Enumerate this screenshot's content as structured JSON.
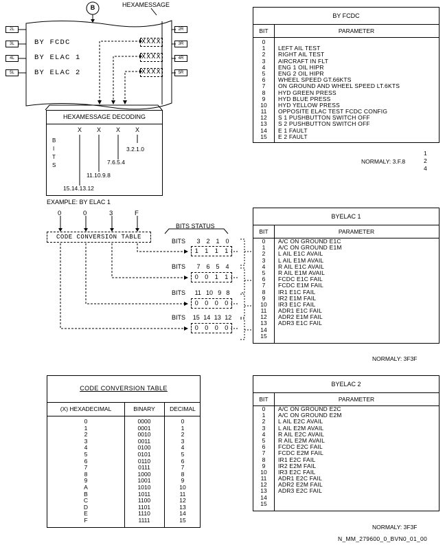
{
  "top_left": {
    "circle_label": "B",
    "hexamessage_label": "HEXAMESSAGE",
    "left_buttons": [
      "2L",
      "3L",
      "4L",
      "5L"
    ],
    "right_buttons": [
      "2R",
      "3R",
      "4R",
      "5R"
    ],
    "screen_lines": [
      {
        "label": "BY FCDC",
        "value": "XXXX"
      },
      {
        "label": "BY ELAC 1",
        "value": "XXXX"
      },
      {
        "label": "BY ELAC 2",
        "value": "XXXX"
      }
    ],
    "decoding_title": "HEXAMESSAGE DECODING",
    "decoding_x": [
      "X",
      "X",
      "X",
      "X"
    ],
    "decoding_bits_label": [
      "B",
      "I",
      "T",
      "S"
    ],
    "decoding_groups": [
      "3.2.1.0",
      "7.6.5.4",
      "11.10.9.8",
      "15.14.13.12"
    ],
    "example": "EXAMPLE: BY ELAC 1"
  },
  "bits_status": {
    "example_digits": [
      "0",
      "0",
      "3",
      "F"
    ],
    "code_conversion_label": "CODE CONVERSION TABLE",
    "title": "BITS STATUS",
    "groups": [
      {
        "label": "BITS",
        "bits": [
          "3",
          "2",
          "1",
          "0"
        ],
        "values": [
          "1",
          "1",
          "1",
          "1"
        ]
      },
      {
        "label": "BITS",
        "bits": [
          "7",
          "6",
          "5",
          "4"
        ],
        "values": [
          "0",
          "0",
          "1",
          "1"
        ]
      },
      {
        "label": "BITS",
        "bits": [
          "11",
          "10",
          "9",
          "8"
        ],
        "values": [
          "0",
          "0",
          "0",
          "0"
        ]
      },
      {
        "label": "BITS",
        "bits": [
          "15",
          "14",
          "13",
          "12"
        ],
        "values": [
          "0",
          "0",
          "0",
          "0"
        ]
      }
    ]
  },
  "code_table": {
    "title": "CODE CONVERSION TABLE",
    "headers": [
      "(X) HEXADECIMAL",
      "BINARY",
      "DECIMAL"
    ],
    "rows": [
      [
        "0",
        "0000",
        "0"
      ],
      [
        "1",
        "0001",
        "1"
      ],
      [
        "2",
        "0010",
        "2"
      ],
      [
        "3",
        "0011",
        "3"
      ],
      [
        "4",
        "0100",
        "4"
      ],
      [
        "5",
        "0101",
        "5"
      ],
      [
        "6",
        "0110",
        "6"
      ],
      [
        "7",
        "0111",
        "7"
      ],
      [
        "8",
        "1000",
        "8"
      ],
      [
        "9",
        "1001",
        "9"
      ],
      [
        "A",
        "1010",
        "10"
      ],
      [
        "B",
        "1011",
        "11"
      ],
      [
        "C",
        "1100",
        "12"
      ],
      [
        "D",
        "1101",
        "13"
      ],
      [
        "E",
        "1110",
        "14"
      ],
      [
        "F",
        "1111",
        "15"
      ]
    ]
  },
  "fcdc_table": {
    "title": "BY FCDC",
    "bit_header": "BIT",
    "param_header": "PARAMETER",
    "rows": [
      [
        "0",
        ""
      ],
      [
        "1",
        "LEFT AIL TEST"
      ],
      [
        "2",
        "RIGHT AIL TEST"
      ],
      [
        "3",
        "AIRCRAFT IN FLT"
      ],
      [
        "4",
        "ENG 1 OIL HIPR"
      ],
      [
        "5",
        "ENG 2 OIL HIPR"
      ],
      [
        "6",
        "WHEEL SPEED GT.66KTS"
      ],
      [
        "7",
        "ON GROUND AND WHEEL SPEED LT.6KTS"
      ],
      [
        "8",
        "HYD GREEN PRESS"
      ],
      [
        "9",
        "HYD BLUE PRESS"
      ],
      [
        "10",
        "HYD YELLOW PRESS"
      ],
      [
        "11",
        "OPPOSITE ELAC TEST FCDC CONFIG"
      ],
      [
        "12",
        "S 1 PUSHBUTTON SWITCH OFF"
      ],
      [
        "13",
        "S 2 PUSHBUTTON SWITCH OFF"
      ],
      [
        "14",
        "E 1 FAULT"
      ],
      [
        "15",
        "E 2 FAULT"
      ]
    ],
    "normaly_label": "NORMALY: 3.F.8",
    "normaly_values": [
      "1",
      "2",
      "4"
    ]
  },
  "elac1_table": {
    "title": "BYELAC 1",
    "bit_header": "BIT",
    "param_header": "PARAMETER",
    "rows": [
      [
        "0",
        "A/C ON GROUND E1C"
      ],
      [
        "1",
        "A/C ON GROUND E1M"
      ],
      [
        "2",
        "L AIL E1C AVAIL"
      ],
      [
        "3",
        "L AIL E1M AVAIL"
      ],
      [
        "4",
        "R AIL E1C AVAIL"
      ],
      [
        "5",
        "R AIL E1M AVAIL"
      ],
      [
        "6",
        "FCDC E1C FAIL"
      ],
      [
        "7",
        "FCDC E1M FAIL"
      ],
      [
        "8",
        "IR1 E1C FAIL"
      ],
      [
        "9",
        "IR2 E1M FAIL"
      ],
      [
        "10",
        "IR3 E1C FAIL"
      ],
      [
        "11",
        "ADR1 E1C FAIL"
      ],
      [
        "12",
        "ADR2 E1M FAIL"
      ],
      [
        "13",
        "ADR3 E1C FAIL"
      ],
      [
        "14",
        ""
      ],
      [
        "15",
        ""
      ]
    ],
    "normaly": "NORMALY: 3F3F"
  },
  "elac2_table": {
    "title": "BYELAC 2",
    "bit_header": "BIT",
    "param_header": "PARAMETER",
    "rows": [
      [
        "0",
        "A/C ON GROUND E2C"
      ],
      [
        "1",
        "A/C ON GROUND E2M"
      ],
      [
        "2",
        "L AIL E2C AVAIL"
      ],
      [
        "3",
        "L AIL E2M AVAIL"
      ],
      [
        "4",
        "R AIL E2C AVAIL"
      ],
      [
        "5",
        "R AIL E2M AVAIL"
      ],
      [
        "6",
        "FCDC E2C FAIL"
      ],
      [
        "7",
        "FCDC E2M FAIL"
      ],
      [
        "8",
        "IR1 E2C FAIL"
      ],
      [
        "9",
        "IR2 E2M FAIL"
      ],
      [
        "10",
        "IR3 E2C FAIL"
      ],
      [
        "11",
        "ADR1 E2C FAIL"
      ],
      [
        "12",
        "ADR2 E2M FAIL"
      ],
      [
        "13",
        "ADR3 E2C FAIL"
      ],
      [
        "14",
        ""
      ],
      [
        "15",
        ""
      ]
    ],
    "normaly": "NORMALY: 3F3F"
  },
  "footer_ref": "N_MM_279600_0_BVN0_01_00"
}
